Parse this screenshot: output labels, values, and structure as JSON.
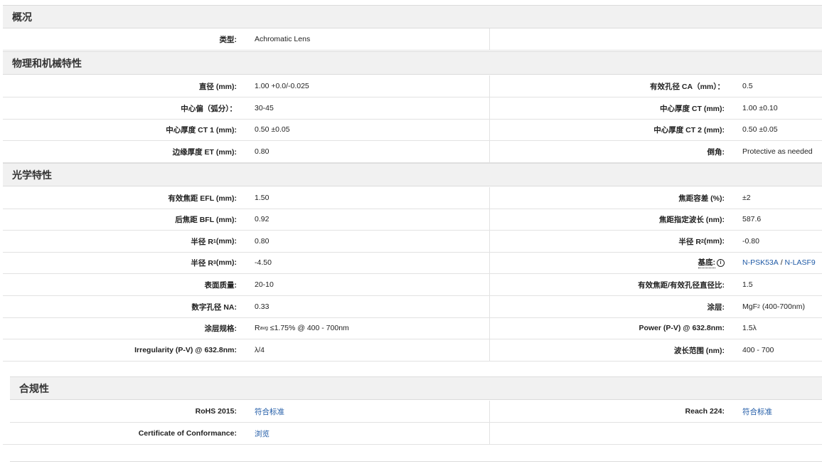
{
  "sections": {
    "overview": "概况",
    "physical": "物理和机械特性",
    "optical": "光学特性",
    "compliance": "合规性"
  },
  "overview": {
    "type_label": "类型:",
    "type_value": "Achromatic Lens"
  },
  "physical": {
    "diameter_label": "直径 (mm):",
    "diameter_value": "1.00 +0.0/-0.025",
    "ca_label": "有效孔径 CA（mm）：",
    "ca_value": "0.5",
    "centering_label": "中心偏（弧分）：",
    "centering_value": "30-45",
    "ct_label": "中心厚度 CT (mm):",
    "ct_value": "1.00 ±0.10",
    "ct1_label": "中心厚度 CT 1 (mm):",
    "ct1_value": "0.50 ±0.05",
    "ct2_label": "中心厚度 CT 2 (mm):",
    "ct2_value": "0.50 ±0.05",
    "et_label": "边缘厚度 ET (mm):",
    "et_value": "0.80",
    "bevel_label": "倒角:",
    "bevel_value": "Protective as needed"
  },
  "optical": {
    "efl_label": "有效焦距 EFL (mm):",
    "efl_value": "1.50",
    "fl_tol_label": "焦距容差 (%):",
    "fl_tol_value": "±2",
    "bfl_label": "后焦距 BFL (mm):",
    "bfl_value": "0.92",
    "design_wl_label": "焦距指定波长 (nm):",
    "design_wl_value": "587.6",
    "r1_prefix": "半径 R",
    "r1_sub": "1",
    "r1_suffix": " (mm):",
    "r1_value": "0.80",
    "r2_prefix": "半径 R",
    "r2_sub": "2",
    "r2_suffix": " (mm):",
    "r2_value": "-0.80",
    "r3_prefix": "半径 R",
    "r3_sub": "3",
    "r3_suffix": " (mm):",
    "r3_value": "-4.50",
    "substrate_label": "基底:",
    "substrate_info": "i",
    "substrate_value_1": "N-PSK53A",
    "substrate_sep": " / ",
    "substrate_value_2": "N-LASF9",
    "surface_label": "表面质量:",
    "surface_value": "20-10",
    "fnum_label": "有效焦距/有效孔径直径比:",
    "fnum_value": "1.5",
    "na_label": "数字孔径 NA:",
    "na_value": "0.33",
    "coating_label": "涂层:",
    "coating_prefix": "MgF",
    "coating_sub": "2",
    "coating_suffix": " (400-700nm)",
    "coating_spec_label": "涂层规格:",
    "coating_spec_prefix": "R",
    "coating_spec_sub": "avg",
    "coating_spec_suffix": " ≤1.75% @ 400 - 700nm",
    "power_label": "Power (P-V) @ 632.8nm:",
    "power_value": "1.5λ",
    "irregularity_label": "Irregularity (P-V) @ 632.8nm:",
    "irregularity_value": "λ/4",
    "wl_range_label": "波长范围 (nm):",
    "wl_range_value": "400 - 700"
  },
  "compliance": {
    "rohs_label": "RoHS 2015:",
    "rohs_value": "符合标准",
    "reach_label": "Reach 224:",
    "reach_value": "符合标准",
    "coc_label": "Certificate of Conformance:",
    "coc_value": "浏览"
  },
  "colors": {
    "header_bg": "#f1f1f1",
    "link": "#1f5aa6",
    "border": "#e2e2e2"
  }
}
